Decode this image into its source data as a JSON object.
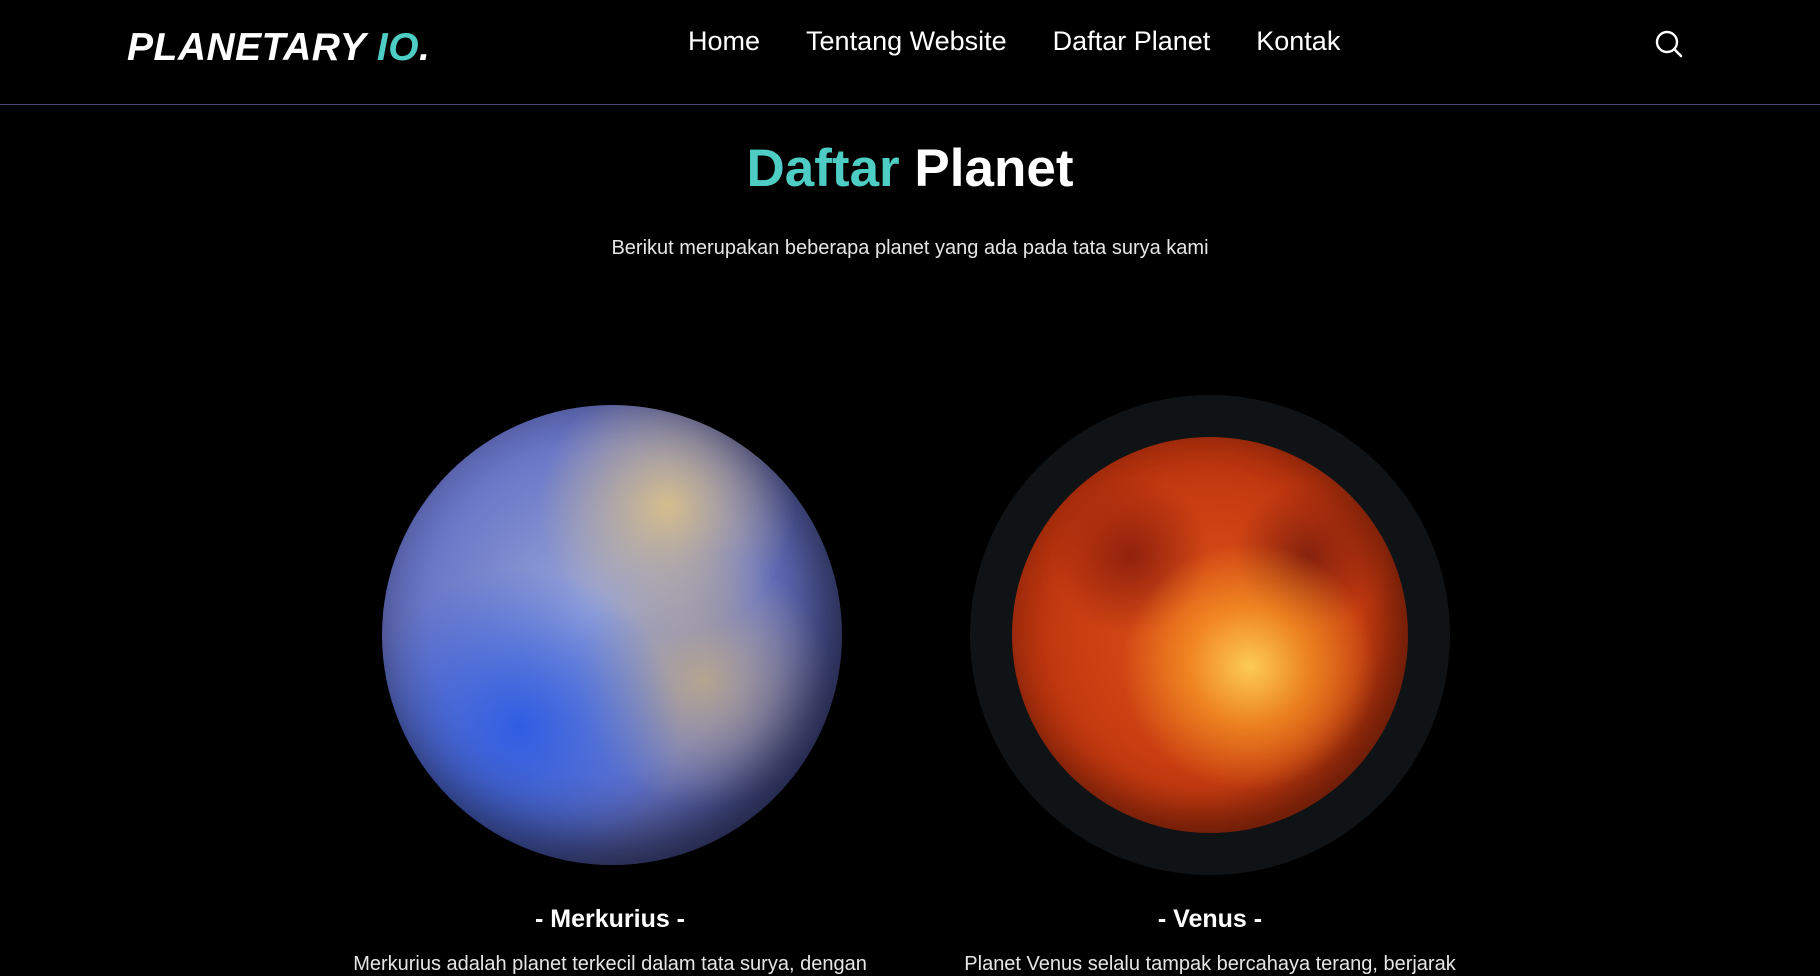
{
  "brand": {
    "name_main": "PLANETARY ",
    "name_accent": "IO",
    "name_dot": "."
  },
  "nav": {
    "items": [
      {
        "label": "Home"
      },
      {
        "label": "Tentang Website"
      },
      {
        "label": "Daftar Planet"
      },
      {
        "label": "Kontak"
      }
    ],
    "search_icon": "search-icon"
  },
  "section": {
    "title_accent": "Daftar",
    "title_rest": " Planet",
    "subtitle": "Berikut merupakan beberapa planet yang ada pada tata surya kami"
  },
  "planets": [
    {
      "name": "- Merkurius -",
      "description": "Merkurius adalah planet terkecil dalam tata surya, dengan"
    },
    {
      "name": "- Venus -",
      "description": "Planet Venus selalu tampak bercahaya terang, berjarak"
    }
  ],
  "colors": {
    "accent": "#4ecdc4",
    "background": "#000000",
    "text": "#ffffff",
    "nav_border": "#4a4a7a"
  }
}
